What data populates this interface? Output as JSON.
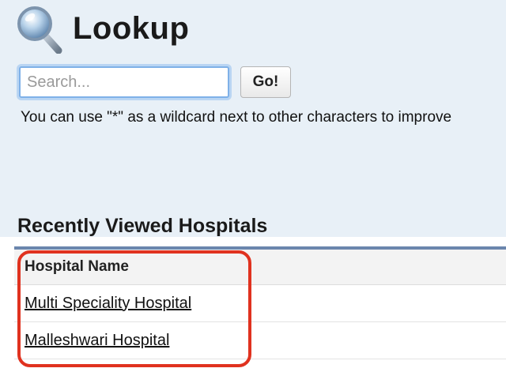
{
  "header": {
    "title": "Lookup",
    "icon": "magnifier-icon"
  },
  "search": {
    "placeholder": "Search...",
    "value": "",
    "button_label": "Go!"
  },
  "hint": "You can use \"*\" as a wildcard next to other characters to improve",
  "recent": {
    "title": "Recently Viewed Hospitals",
    "column_header": "Hospital Name",
    "rows": [
      "Multi Speciality Hospital",
      "Malleshwari Hospital"
    ]
  },
  "colors": {
    "header_band": "#e8f0f7",
    "table_top_border": "#6b86ad",
    "annotation": "#e0321f",
    "search_focus": "#7fb1e8"
  }
}
